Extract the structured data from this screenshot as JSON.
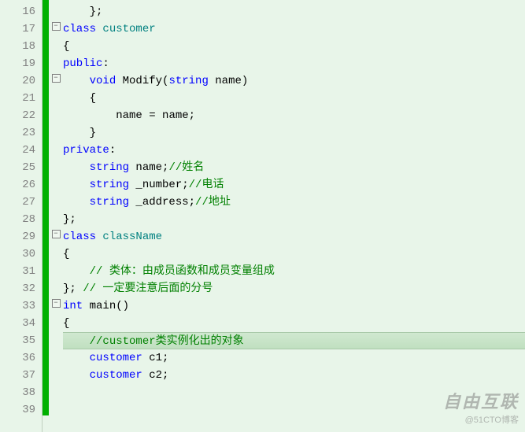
{
  "watermark": {
    "main": "自由互联",
    "sub": "@51CTO博客"
  },
  "foldGlyph": "−",
  "lines": [
    {
      "n": 16,
      "fold": false,
      "hl": false,
      "tokens": [
        {
          "t": "    ",
          "c": ""
        },
        {
          "t": "};",
          "c": "punct"
        }
      ]
    },
    {
      "n": 17,
      "fold": true,
      "hl": false,
      "tokens": [
        {
          "t": "class ",
          "c": "kw"
        },
        {
          "t": "customer",
          "c": "green-name"
        }
      ]
    },
    {
      "n": 18,
      "fold": false,
      "hl": false,
      "tokens": [
        {
          "t": "{",
          "c": "punct"
        }
      ]
    },
    {
      "n": 19,
      "fold": false,
      "hl": false,
      "tokens": [
        {
          "t": "public",
          "c": "kw"
        },
        {
          "t": ":",
          "c": "punct"
        }
      ]
    },
    {
      "n": 20,
      "fold": true,
      "hl": false,
      "tokens": [
        {
          "t": "    ",
          "c": ""
        },
        {
          "t": "void ",
          "c": "kw"
        },
        {
          "t": "Modify",
          "c": "ident"
        },
        {
          "t": "(",
          "c": "punct"
        },
        {
          "t": "string ",
          "c": "kw"
        },
        {
          "t": "name",
          "c": "ident"
        },
        {
          "t": ")",
          "c": "punct"
        }
      ]
    },
    {
      "n": 21,
      "fold": false,
      "hl": false,
      "tokens": [
        {
          "t": "    {",
          "c": "punct"
        }
      ]
    },
    {
      "n": 22,
      "fold": false,
      "hl": false,
      "tokens": [
        {
          "t": "        ",
          "c": ""
        },
        {
          "t": "name ",
          "c": "ident"
        },
        {
          "t": "= ",
          "c": "punct"
        },
        {
          "t": "name",
          "c": "ident"
        },
        {
          "t": ";",
          "c": "punct"
        }
      ]
    },
    {
      "n": 23,
      "fold": false,
      "hl": false,
      "tokens": [
        {
          "t": "    }",
          "c": "punct"
        }
      ]
    },
    {
      "n": 24,
      "fold": false,
      "hl": false,
      "tokens": [
        {
          "t": "private",
          "c": "kw"
        },
        {
          "t": ":",
          "c": "punct"
        }
      ]
    },
    {
      "n": 25,
      "fold": false,
      "hl": false,
      "tokens": [
        {
          "t": "    ",
          "c": ""
        },
        {
          "t": "string ",
          "c": "kw"
        },
        {
          "t": "name",
          "c": "ident"
        },
        {
          "t": ";",
          "c": "punct"
        },
        {
          "t": "//姓名",
          "c": "comment"
        }
      ]
    },
    {
      "n": 26,
      "fold": false,
      "hl": false,
      "tokens": [
        {
          "t": "    ",
          "c": ""
        },
        {
          "t": "string ",
          "c": "kw"
        },
        {
          "t": "_number",
          "c": "ident"
        },
        {
          "t": ";",
          "c": "punct"
        },
        {
          "t": "//电话",
          "c": "comment"
        }
      ]
    },
    {
      "n": 27,
      "fold": false,
      "hl": false,
      "tokens": [
        {
          "t": "    ",
          "c": ""
        },
        {
          "t": "string ",
          "c": "kw"
        },
        {
          "t": "_address",
          "c": "ident"
        },
        {
          "t": ";",
          "c": "punct"
        },
        {
          "t": "//地址",
          "c": "comment"
        }
      ]
    },
    {
      "n": 28,
      "fold": false,
      "hl": false,
      "tokens": [
        {
          "t": "};",
          "c": "punct"
        }
      ]
    },
    {
      "n": 29,
      "fold": true,
      "hl": false,
      "tokens": [
        {
          "t": "class ",
          "c": "kw"
        },
        {
          "t": "className",
          "c": "green-name"
        }
      ]
    },
    {
      "n": 30,
      "fold": false,
      "hl": false,
      "tokens": [
        {
          "t": "{",
          "c": "punct"
        }
      ]
    },
    {
      "n": 31,
      "fold": false,
      "hl": false,
      "tokens": [
        {
          "t": "    ",
          "c": ""
        },
        {
          "t": "// 类体：由成员函数和成员变量组成",
          "c": "comment"
        }
      ]
    },
    {
      "n": 32,
      "fold": false,
      "hl": false,
      "tokens": [
        {
          "t": "}; ",
          "c": "punct"
        },
        {
          "t": "// 一定要注意后面的分号",
          "c": "comment"
        }
      ]
    },
    {
      "n": 33,
      "fold": true,
      "hl": false,
      "tokens": [
        {
          "t": "int ",
          "c": "kw"
        },
        {
          "t": "main",
          "c": "ident"
        },
        {
          "t": "()",
          "c": "punct"
        }
      ]
    },
    {
      "n": 34,
      "fold": false,
      "hl": false,
      "tokens": [
        {
          "t": "{",
          "c": "punct"
        }
      ]
    },
    {
      "n": 35,
      "fold": false,
      "hl": true,
      "tokens": [
        {
          "t": "    ",
          "c": ""
        },
        {
          "t": "//customer类实例化出的对象",
          "c": "comment"
        }
      ]
    },
    {
      "n": 36,
      "fold": false,
      "hl": false,
      "tokens": [
        {
          "t": "    ",
          "c": ""
        },
        {
          "t": "customer ",
          "c": "kw"
        },
        {
          "t": "c1",
          "c": "ident"
        },
        {
          "t": ";",
          "c": "punct"
        }
      ]
    },
    {
      "n": 37,
      "fold": false,
      "hl": false,
      "tokens": [
        {
          "t": "    ",
          "c": ""
        },
        {
          "t": "customer ",
          "c": "kw"
        },
        {
          "t": "c2",
          "c": "ident"
        },
        {
          "t": ";",
          "c": "punct"
        }
      ]
    },
    {
      "n": 38,
      "fold": false,
      "hl": false,
      "tokens": []
    },
    {
      "n": 39,
      "fold": false,
      "hl": false,
      "tokens": []
    }
  ]
}
